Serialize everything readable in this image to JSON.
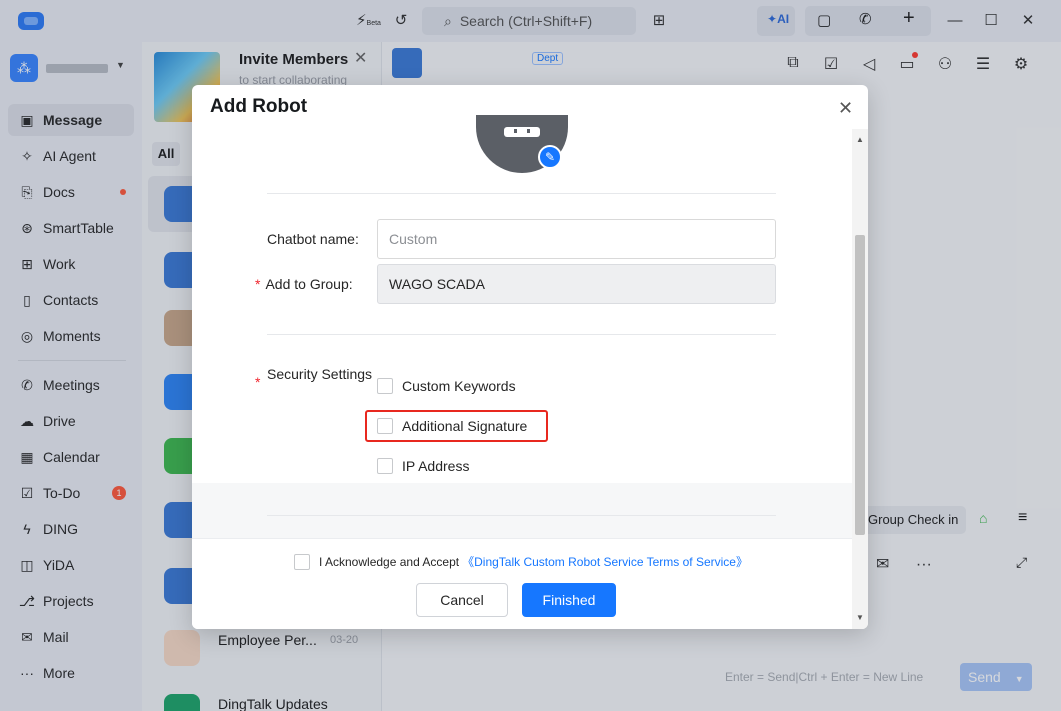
{
  "titlebar": {
    "search_placeholder": "Search (Ctrl+Shift+F)",
    "beta_label": "Beta",
    "ai_label": "AI"
  },
  "sidebar": {
    "items": [
      {
        "label": "Message",
        "icon": "message-icon"
      },
      {
        "label": "AI Agent",
        "icon": "ai-agent-icon"
      },
      {
        "label": "Docs",
        "icon": "docs-icon"
      },
      {
        "label": "SmartTable",
        "icon": "smarttable-icon"
      },
      {
        "label": "Work",
        "icon": "work-icon"
      },
      {
        "label": "Contacts",
        "icon": "contacts-icon"
      },
      {
        "label": "Moments",
        "icon": "moments-icon"
      },
      {
        "label": "Meetings",
        "icon": "meetings-icon"
      },
      {
        "label": "Drive",
        "icon": "drive-icon"
      },
      {
        "label": "Calendar",
        "icon": "calendar-icon"
      },
      {
        "label": "To-Do",
        "icon": "todo-icon",
        "badge": "1"
      },
      {
        "label": "DING",
        "icon": "ding-icon"
      },
      {
        "label": "YiDA",
        "icon": "yida-icon"
      },
      {
        "label": "Projects",
        "icon": "projects-icon"
      },
      {
        "label": "Mail",
        "icon": "mail-icon"
      },
      {
        "label": "More",
        "icon": "more-icon"
      }
    ]
  },
  "list_panel": {
    "invite_title": "Invite Members",
    "invite_subtitle": "to start collaborating",
    "tab_all": "All",
    "chats": [
      {
        "title": "Employee Per...",
        "date": "03-20"
      },
      {
        "title": "DingTalk Updates",
        "date": ""
      }
    ]
  },
  "chat_panel": {
    "dept_tag": "Dept",
    "group_checkin": "Group Check in",
    "input_hint": "Enter = Send|Ctrl + Enter = New Line",
    "send_label": "Send"
  },
  "dialog": {
    "title": "Add Robot",
    "chatbot_name_label": "Chatbot name:",
    "chatbot_name_placeholder": "Custom",
    "add_to_group_label": "Add to Group:",
    "add_to_group_value": "WAGO SCADA",
    "required_mark": "*",
    "security_label": "Security Settings",
    "options": [
      "Custom Keywords",
      "Additional Signature",
      "IP Address"
    ],
    "agree_text": "I Acknowledge and Accept",
    "terms_link": "《DingTalk Custom Robot Service Terms of Service》",
    "cancel_label": "Cancel",
    "finish_label": "Finished"
  },
  "colors": {
    "primary": "#1677ff",
    "highlight_box": "#e8281f",
    "required": "#f0262e"
  }
}
